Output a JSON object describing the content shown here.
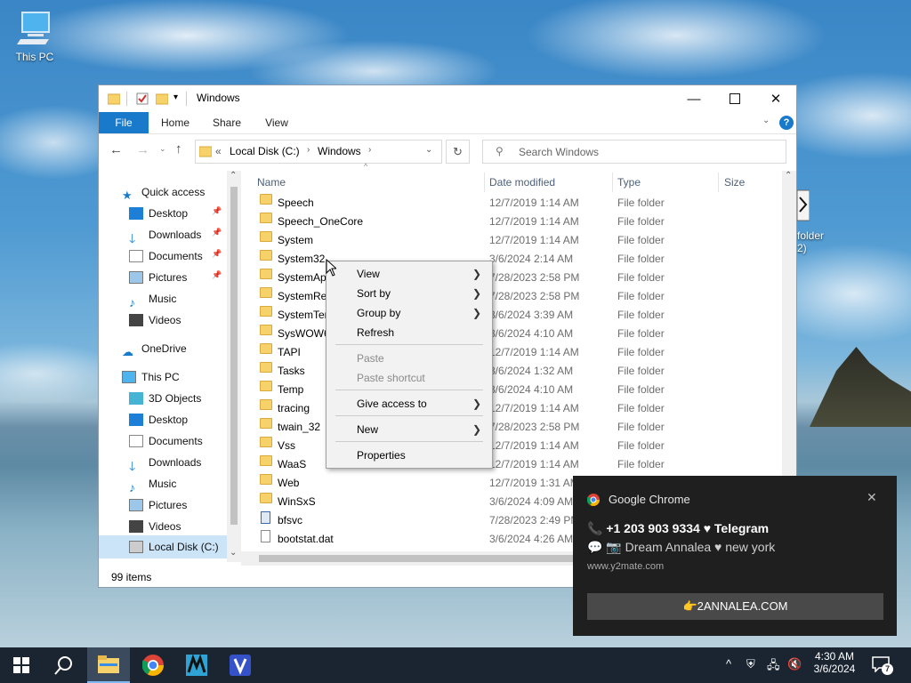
{
  "desktop": {
    "icons": [
      {
        "label": "This PC"
      },
      {
        "label": "folder"
      },
      {
        "label": "2)"
      }
    ]
  },
  "window": {
    "title": "Windows",
    "ribbon_tabs": [
      "File",
      "Home",
      "Share",
      "View"
    ],
    "address": {
      "chevron": "«",
      "segments": [
        "Local Disk (C:)",
        "Windows"
      ]
    },
    "search_placeholder": "Search Windows",
    "nav": {
      "quick_access": "Quick access",
      "quick_items": [
        "Desktop",
        "Downloads",
        "Documents",
        "Pictures",
        "Music",
        "Videos"
      ],
      "onedrive": "OneDrive",
      "this_pc": "This PC",
      "pc_items": [
        "3D Objects",
        "Desktop",
        "Documents",
        "Downloads",
        "Music",
        "Pictures",
        "Videos",
        "Local Disk (C:)"
      ]
    },
    "columns": [
      "Name",
      "Date modified",
      "Type",
      "Size"
    ],
    "rows": [
      {
        "name": "Speech",
        "date": "12/7/2019 1:14 AM",
        "type": "File folder",
        "kind": "folder"
      },
      {
        "name": "Speech_OneCore",
        "date": "12/7/2019 1:14 AM",
        "type": "File folder",
        "kind": "folder"
      },
      {
        "name": "System",
        "date": "12/7/2019 1:14 AM",
        "type": "File folder",
        "kind": "folder"
      },
      {
        "name": "System32",
        "date": "3/6/2024 2:14 AM",
        "type": "File folder",
        "kind": "folder"
      },
      {
        "name": "SystemApps",
        "date": "7/28/2023 2:58 PM",
        "type": "File folder",
        "kind": "folder"
      },
      {
        "name": "SystemResources",
        "date": "7/28/2023 2:58 PM",
        "type": "File folder",
        "kind": "folder"
      },
      {
        "name": "SystemTemp",
        "date": "3/6/2024 3:39 AM",
        "type": "File folder",
        "kind": "folder"
      },
      {
        "name": "SysWOW64",
        "date": "3/6/2024 4:10 AM",
        "type": "File folder",
        "kind": "folder"
      },
      {
        "name": "TAPI",
        "date": "12/7/2019 1:14 AM",
        "type": "File folder",
        "kind": "folder"
      },
      {
        "name": "Tasks",
        "date": "3/6/2024 1:32 AM",
        "type": "File folder",
        "kind": "folder"
      },
      {
        "name": "Temp",
        "date": "3/6/2024 4:10 AM",
        "type": "File folder",
        "kind": "folder"
      },
      {
        "name": "tracing",
        "date": "12/7/2019 1:14 AM",
        "type": "File folder",
        "kind": "folder"
      },
      {
        "name": "twain_32",
        "date": "7/28/2023 2:58 PM",
        "type": "File folder",
        "kind": "folder"
      },
      {
        "name": "Vss",
        "date": "12/7/2019 1:14 AM",
        "type": "File folder",
        "kind": "folder"
      },
      {
        "name": "WaaS",
        "date": "12/7/2019 1:14 AM",
        "type": "File folder",
        "kind": "folder"
      },
      {
        "name": "Web",
        "date": "12/7/2019 1:31 AM",
        "type": "",
        "kind": "folder"
      },
      {
        "name": "WinSxS",
        "date": "3/6/2024 4:09 AM",
        "type": "",
        "kind": "folder"
      },
      {
        "name": "bfsvc",
        "date": "7/28/2023 2:49 PM",
        "type": "",
        "kind": "app"
      },
      {
        "name": "bootstat.dat",
        "date": "3/6/2024 4:26 AM",
        "type": "",
        "kind": "file"
      }
    ],
    "status": "99 items"
  },
  "context_menu": {
    "items": [
      {
        "label": "View",
        "submenu": true,
        "disabled": false
      },
      {
        "label": "Sort by",
        "submenu": true,
        "disabled": false
      },
      {
        "label": "Group by",
        "submenu": true,
        "disabled": false
      },
      {
        "label": "Refresh",
        "submenu": false,
        "disabled": false
      },
      {
        "label": "Paste",
        "submenu": false,
        "disabled": true
      },
      {
        "label": "Paste shortcut",
        "submenu": false,
        "disabled": true
      },
      {
        "label": "Give access to",
        "submenu": true,
        "disabled": false
      },
      {
        "label": "New",
        "submenu": true,
        "disabled": false
      },
      {
        "label": "Properties",
        "submenu": false,
        "disabled": false
      }
    ]
  },
  "notification": {
    "app": "Google Chrome",
    "title": "📞 +1 203 903 9334 ♥ Telegram",
    "body": "💬 📷 Dream Annalea ♥ new york",
    "site": "www.y2mate.com",
    "button": "👉2ANNALEA.COM"
  },
  "taskbar": {
    "time": "4:30 AM",
    "date": "3/6/2024",
    "notification_count": "7"
  },
  "colors": {
    "accent": "#1979ca",
    "file_tab": "#1979ca",
    "taskbar": "#1b2531",
    "toast_bg": "#1f1f1f"
  }
}
